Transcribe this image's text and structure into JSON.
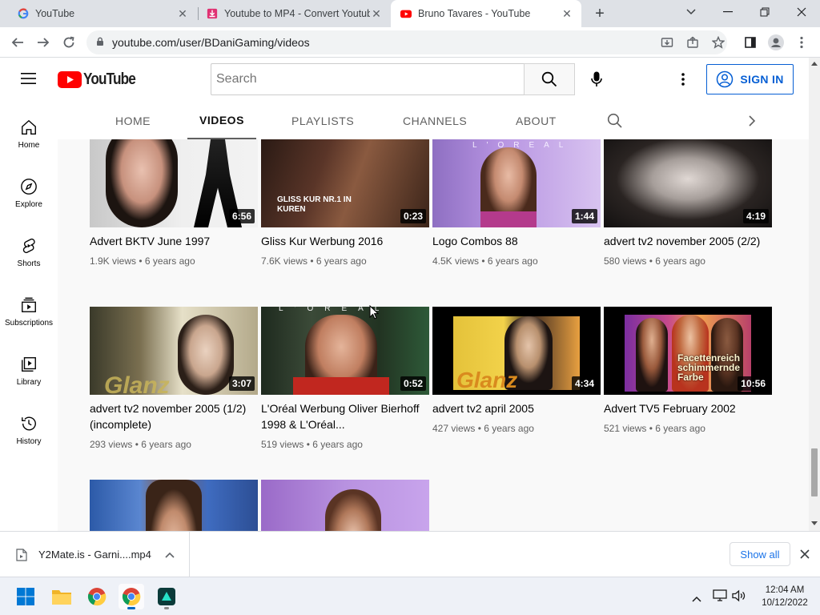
{
  "browser": {
    "tabs": [
      {
        "title": "YouTube",
        "favicon": "google-icon"
      },
      {
        "title": "Youtube to MP4 - Convert Youtube",
        "favicon": "y2mate-icon"
      },
      {
        "title": "Bruno Tavares - YouTube",
        "favicon": "youtube-icon",
        "active": true
      }
    ],
    "url": "youtube.com/user/BDaniGaming/videos"
  },
  "masthead": {
    "logo_text": "YouTube",
    "search_placeholder": "Search",
    "signin_label": "SIGN IN"
  },
  "sidebar": {
    "items": [
      {
        "label": "Home",
        "icon": "home-icon"
      },
      {
        "label": "Explore",
        "icon": "compass-icon"
      },
      {
        "label": "Shorts",
        "icon": "shorts-icon"
      },
      {
        "label": "Subscriptions",
        "icon": "subscriptions-icon"
      },
      {
        "label": "Library",
        "icon": "library-icon"
      },
      {
        "label": "History",
        "icon": "history-icon"
      }
    ]
  },
  "channel_tabs": [
    "HOME",
    "VIDEOS",
    "PLAYLISTS",
    "CHANNELS",
    "ABOUT"
  ],
  "videos": [
    {
      "title": "Advert BKTV June 1997",
      "duration": "6:56",
      "views": "1.9K views",
      "age": "6 years ago"
    },
    {
      "title": "Gliss Kur Werbung 2016",
      "duration": "0:23",
      "views": "7.6K views",
      "age": "6 years ago",
      "thumb_text": "GLISS KUR NR.1 IN KUREN"
    },
    {
      "title": "Logo Combos 88",
      "duration": "1:44",
      "views": "4.5K views",
      "age": "6 years ago",
      "thumb_text": "L'OREAL"
    },
    {
      "title": "advert tv2 november 2005 (2/2)",
      "duration": "4:19",
      "views": "580 views",
      "age": "6 years ago"
    },
    {
      "title": "advert tv2 november 2005 (1/2) (incomplete)",
      "duration": "3:07",
      "views": "293 views",
      "age": "6 years ago",
      "thumb_text": "Glanz"
    },
    {
      "title": "L'Oréal Werbung Oliver Bierhoff 1998 & L'Oréal...",
      "duration": "0:52",
      "views": "519 views",
      "age": "6 years ago",
      "thumb_text": "L'OREAL"
    },
    {
      "title": "advert tv2 april 2005",
      "duration": "4:34",
      "views": "427 views",
      "age": "6 years ago",
      "thumb_text": "Glanz"
    },
    {
      "title": "Advert TV5 February 2002",
      "duration": "10:56",
      "views": "521 views",
      "age": "6 years ago",
      "thumb_text": "Facettenreich schimmernde Farbe"
    }
  ],
  "download": {
    "filename": "Y2Mate.is - Garni....mp4",
    "show_all": "Show all"
  },
  "taskbar": {
    "time": "12:04 AM",
    "date": "10/12/2022"
  }
}
